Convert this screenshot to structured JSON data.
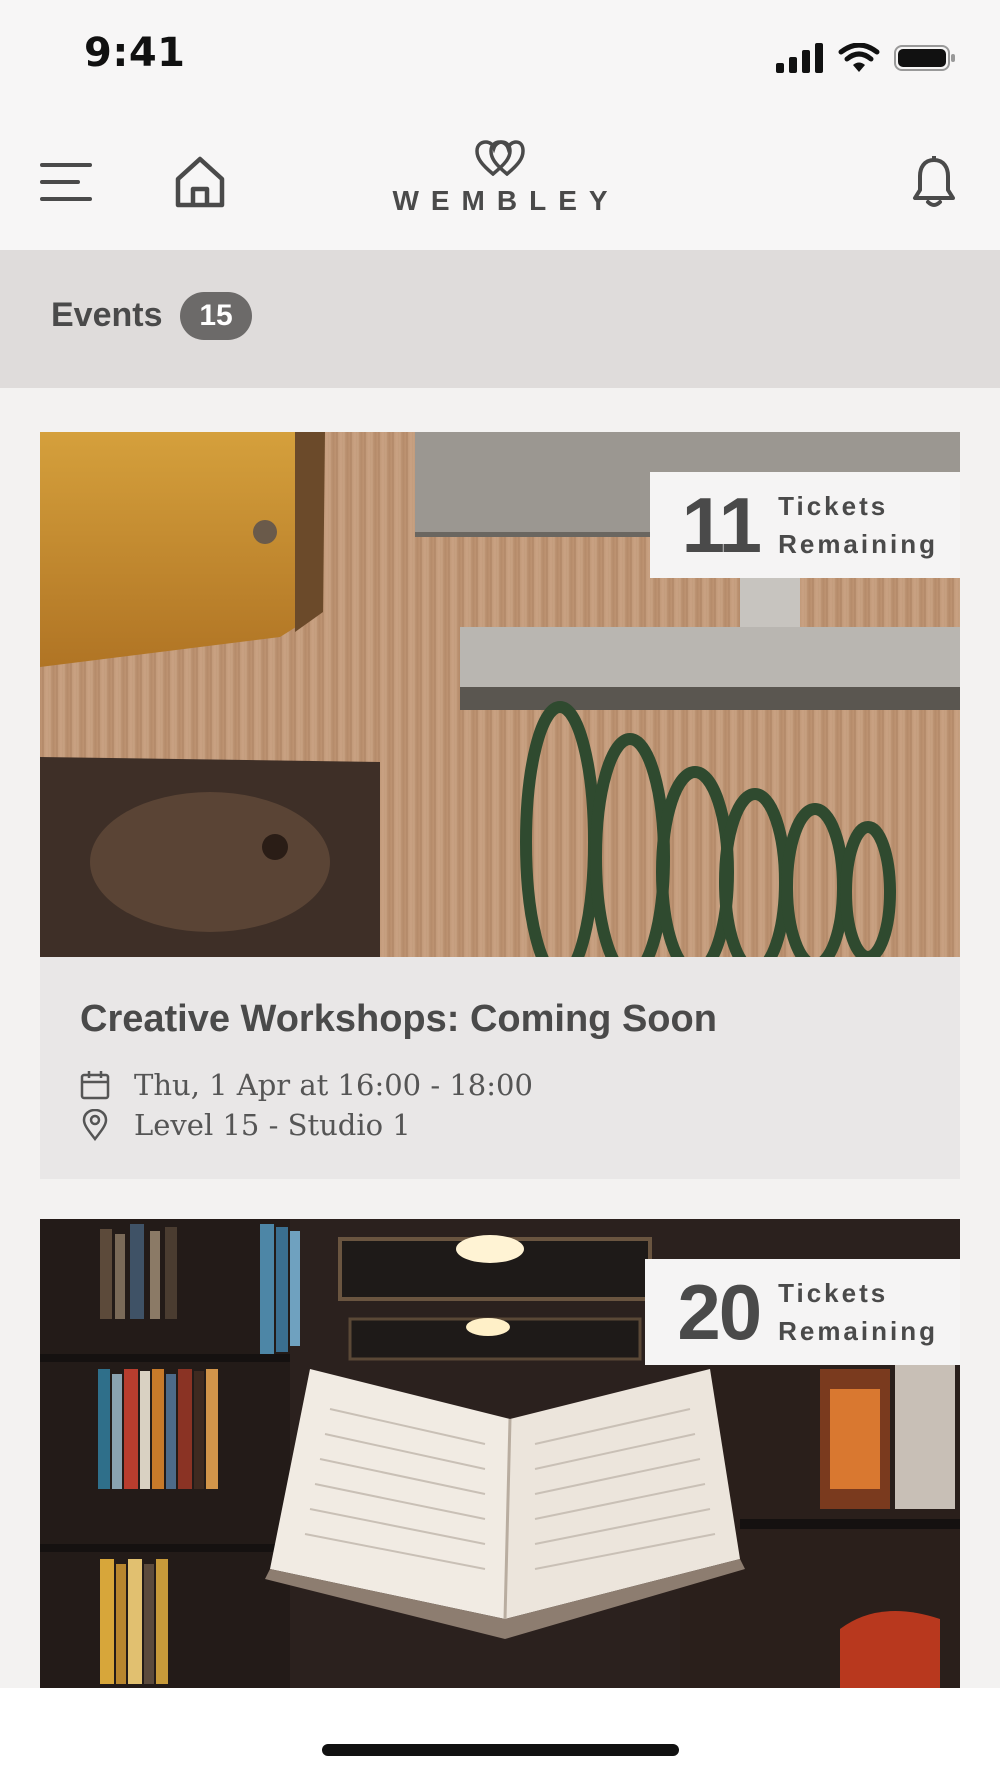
{
  "status_bar": {
    "time": "9:41"
  },
  "header": {
    "brand": "WEMBLEY"
  },
  "events_header": {
    "title": "Events",
    "count": "15"
  },
  "events": [
    {
      "tickets_count": "11",
      "tickets_label_line1": "Tickets",
      "tickets_label_line2": "Remaining",
      "title": "Creative Workshops: Coming Soon",
      "datetime": "Thu, 1 Apr at 16:00 - 18:00",
      "location": "Level 15 - Studio 1"
    },
    {
      "tickets_count": "20",
      "tickets_label_line1": "Tickets",
      "tickets_label_line2": "Remaining"
    }
  ],
  "colors": {
    "background": "#f3f2f1",
    "events_bar": "#dfdcdb",
    "count_badge": "#6c6a69",
    "card": "#e9e7e7",
    "text": "#4a4a4a"
  },
  "icons": {
    "menu": "hamburger-icon",
    "home": "home-icon",
    "brand": "hearts-logo-icon",
    "notifications": "bell-icon",
    "date": "calendar-icon",
    "location": "map-pin-icon"
  }
}
